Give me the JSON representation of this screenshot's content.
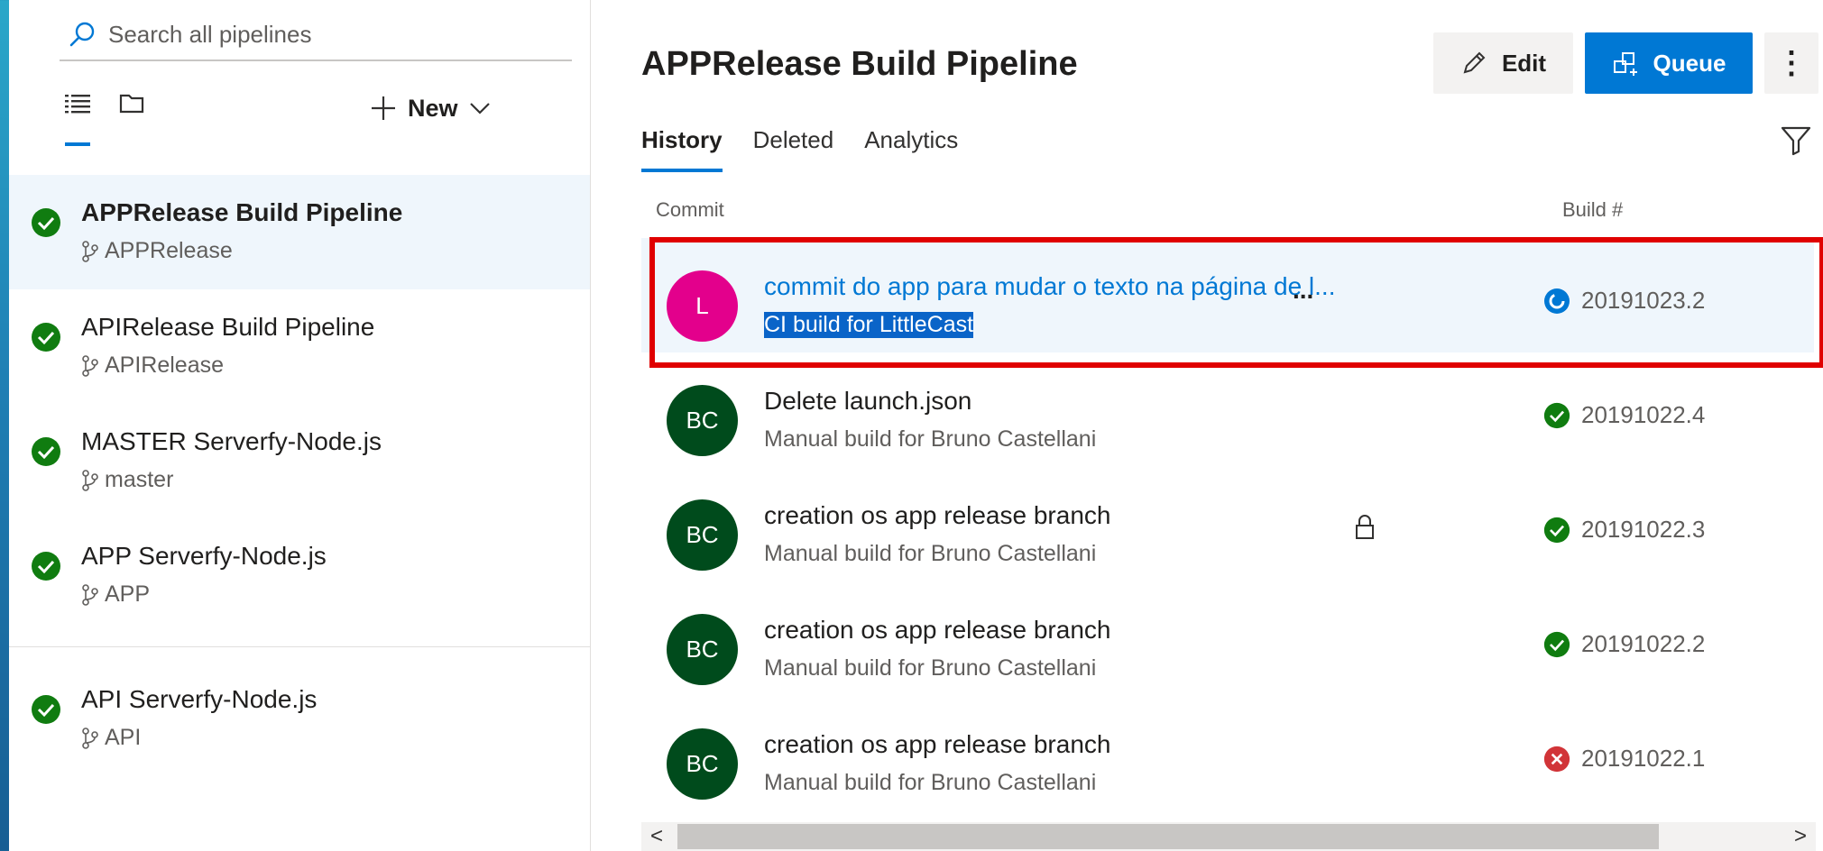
{
  "sidebar": {
    "search_placeholder": "Search all pipelines",
    "new_label": "New",
    "pipelines": [
      {
        "name": "APPRelease Build Pipeline",
        "branch": "APPRelease",
        "status": "succeeded",
        "selected": true
      },
      {
        "name": "APIRelease Build Pipeline",
        "branch": "APIRelease",
        "status": "succeeded"
      },
      {
        "name": "MASTER Serverfy-Node.js",
        "branch": "master",
        "status": "succeeded"
      },
      {
        "name": "APP Serverfy-Node.js",
        "branch": "APP",
        "status": "succeeded"
      },
      {
        "name": "API Serverfy-Node.js",
        "branch": "API",
        "status": "succeeded"
      }
    ]
  },
  "header": {
    "title": "APPRelease Build Pipeline",
    "edit_label": "Edit",
    "queue_label": "Queue",
    "more_label": "⋮"
  },
  "tabs": [
    {
      "label": "History",
      "active": true
    },
    {
      "label": "Deleted"
    },
    {
      "label": "Analytics"
    }
  ],
  "table": {
    "col_commit": "Commit",
    "col_build": "Build #",
    "runs": [
      {
        "initials": "L",
        "avatar_color": "#e3008c",
        "title": "commit do app para mudar o texto na página de l...",
        "subtitle": "CI build for LittleCast",
        "build": "20191023.2",
        "status": "in-progress",
        "more": "..."
      },
      {
        "initials": "BC",
        "avatar_color": "#004b1c",
        "title": "Delete launch.json",
        "subtitle": "Manual build for Bruno Castellani",
        "build": "20191022.4",
        "status": "succeeded"
      },
      {
        "initials": "BC",
        "avatar_color": "#004b1c",
        "title": "creation os app release branch",
        "subtitle": "Manual build for Bruno Castellani",
        "build": "20191022.3",
        "status": "succeeded",
        "locked": true
      },
      {
        "initials": "BC",
        "avatar_color": "#004b1c",
        "title": "creation os app release branch",
        "subtitle": "Manual build for Bruno Castellani",
        "build": "20191022.2",
        "status": "succeeded"
      },
      {
        "initials": "BC",
        "avatar_color": "#004b1c",
        "title": "creation os app release branch",
        "subtitle": "Manual build for Bruno Castellani",
        "build": "20191022.1",
        "status": "failed"
      }
    ]
  },
  "colors": {
    "accent": "#0078d4",
    "success": "#107c10",
    "failure": "#d13438",
    "highlight_border": "#e00000"
  }
}
